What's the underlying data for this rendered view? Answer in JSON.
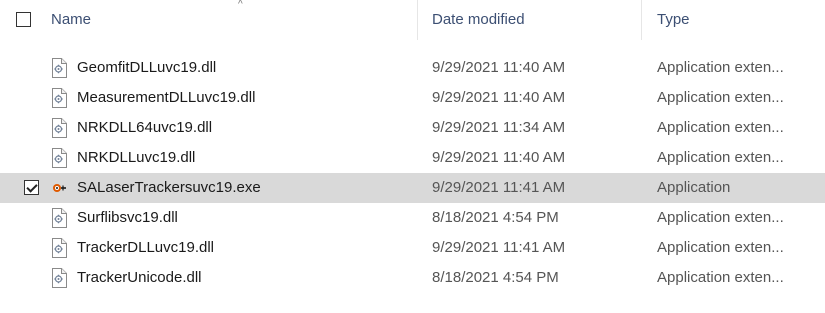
{
  "header": {
    "name_label": "Name",
    "date_label": "Date modified",
    "type_label": "Type",
    "sort_glyph": "^"
  },
  "files": [
    {
      "name": "GeomfitDLLuvc19.dll",
      "date": "9/29/2021 11:40 AM",
      "type": "Application exten...",
      "icon": "dll-file-icon",
      "selected": false
    },
    {
      "name": "MeasurementDLLuvc19.dll",
      "date": "9/29/2021 11:40 AM",
      "type": "Application exten...",
      "icon": "dll-file-icon",
      "selected": false
    },
    {
      "name": "NRKDLL64uvc19.dll",
      "date": "9/29/2021 11:34 AM",
      "type": "Application exten...",
      "icon": "dll-file-icon",
      "selected": false
    },
    {
      "name": "NRKDLLuvc19.dll",
      "date": "9/29/2021 11:40 AM",
      "type": "Application exten...",
      "icon": "dll-file-icon",
      "selected": false
    },
    {
      "name": "SALaserTrackersuvc19.exe",
      "date": "9/29/2021 11:41 AM",
      "type": "Application",
      "icon": "laser-tracker-app-icon",
      "selected": true
    },
    {
      "name": "Surflibsvc19.dll",
      "date": "8/18/2021 4:54 PM",
      "type": "Application exten...",
      "icon": "dll-file-icon",
      "selected": false
    },
    {
      "name": "TrackerDLLuvc19.dll",
      "date": "9/29/2021 11:41 AM",
      "type": "Application exten...",
      "icon": "dll-file-icon",
      "selected": false
    },
    {
      "name": "TrackerUnicode.dll",
      "date": "8/18/2021 4:54 PM",
      "type": "Application exten...",
      "icon": "dll-file-icon",
      "selected": false
    }
  ],
  "colors": {
    "header_text": "#3c4f73",
    "selected_row": "#d9d9d9",
    "exe_icon_accent": "#e05a00"
  }
}
